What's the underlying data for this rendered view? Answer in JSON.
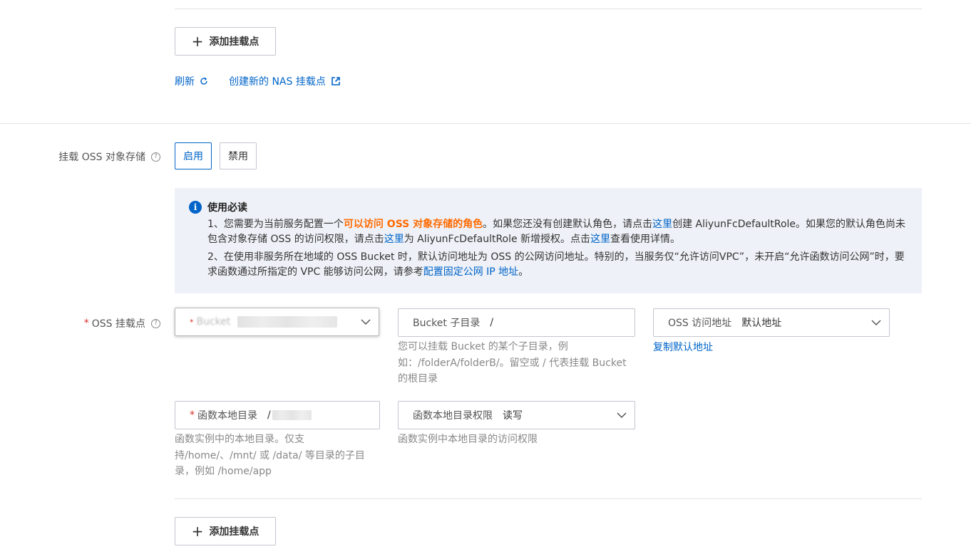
{
  "nas": {
    "add_button": "添加挂载点",
    "refresh_link": "刷新",
    "create_nas_link": "创建新的 NAS 挂载点"
  },
  "oss_mount": {
    "label": "挂载 OSS 对象存储",
    "options": [
      "启用",
      "禁用"
    ],
    "selected": "启用"
  },
  "notice": {
    "title": "使用必读",
    "p1_a": "1、您需要为当前服务配置一个",
    "p1_hl": "可以访问 OSS 对象存储的角色",
    "p1_b": "。如果您还没有创建默认角色，请点击",
    "p1_link1": "这里",
    "p1_c": "创建 AliyunFcDefaultRole。如果您的默认角色尚未包含对象存储 OSS 的访问权限，请点击",
    "p1_link2": "这里",
    "p1_d": "为 AliyunFcDefaultRole 新增授权。点击",
    "p1_link3": "这里",
    "p1_e": "查看使用详情。",
    "p2_a": "2、在使用非服务所在地域的 OSS Bucket 时，默认访问地址为 OSS 的公网访问地址。特别的，当服务仅“允许访问VPC”，未开启“允许函数访问公网”时，要求函数通过所指定的 VPC 能够访问公网，请参考",
    "p2_link": "配置固定公网 IP 地址",
    "p2_b": "。"
  },
  "oss_point": {
    "label": "OSS 挂载点",
    "bucket_placeholder": "Bucket",
    "subdir_label": "Bucket 子目录",
    "subdir_value": "/",
    "subdir_help": "您可以挂载 Bucket 的某个子目录，例如：/folderA/folderB/。留空或 / 代表挂载 Bucket 的根目录",
    "endpoint_label": "OSS 访问地址",
    "endpoint_value": "默认地址",
    "copy_default_link": "复制默认地址",
    "local_dir_label": "函数本地目录",
    "local_dir_value": "/",
    "local_dir_help": "函数实例中的本地目录。仅支持/home/、/mnt/ 或 /data/ 等目录的子目录，例如 /home/app",
    "permission_label": "函数本地目录权限",
    "permission_value": "读写",
    "permission_help": "函数实例中本地目录的访问权限"
  },
  "oss_add_button": "添加挂载点",
  "colors": {
    "primary": "#0064c8",
    "highlight": "#ff6a00",
    "required": "#d93026"
  }
}
